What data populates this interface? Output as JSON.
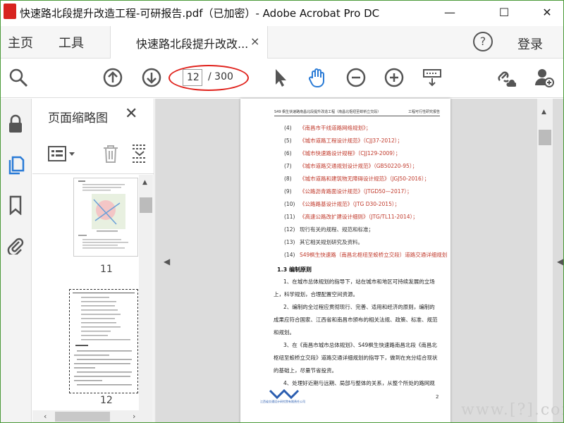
{
  "window": {
    "title": "快速路北段提升改造工程-可研报告.pdf（已加密）- Adobe Acrobat Pro DC",
    "minimize_glyph": "—",
    "maximize_glyph": "☐",
    "close_glyph": "✕"
  },
  "menu": {
    "home": "主页",
    "tools": "工具",
    "doc_tab": "快速路北段提升改改...",
    "doc_tab_close": "×",
    "help": "?",
    "login": "登录"
  },
  "toolbar": {
    "current_page": "12",
    "total_pages": "/ 300",
    "icons": [
      "zoom-search-icon",
      "prev-page-icon",
      "next-page-icon",
      "select-cursor-icon",
      "hand-tool-icon",
      "zoom-out-icon",
      "zoom-in-icon",
      "keyboard-icon",
      "share-link-icon",
      "add-user-icon"
    ]
  },
  "thumbnails": {
    "title": "页面缩略图",
    "close": "✕",
    "pages": [
      {
        "label": "11"
      },
      {
        "label": "12"
      }
    ]
  },
  "document": {
    "header_left": "S49 枫生快速路南昌北段提升改造工程（南昌北枢纽至蛟桥立交段）",
    "header_right": "工程可行性研究报告",
    "references": [
      {
        "num": "(4)",
        "text": "《南昌市干线道路网络规划》；"
      },
      {
        "num": "(5)",
        "text": "《城市道路工程设计规范》（CJJ37-2012）；"
      },
      {
        "num": "(6)",
        "text": "《城市快速路设计规程》（CJJ129-2009）；"
      },
      {
        "num": "(7)",
        "text": "《城市道路交通规划设计规范》（GB50220-95）；"
      },
      {
        "num": "(8)",
        "text": "《城市道路和建筑物无障碍设计规范》（JGJ50-2016）；"
      },
      {
        "num": "(9)",
        "text": "《公路沥青路面设计规范》（JTGD50—2017）；"
      },
      {
        "num": "(10)",
        "text": "《公路路基设计规范》（JTG D30-2015）；"
      },
      {
        "num": "(11)",
        "text": "《高速公路改扩建设计细则》（JTG/TL11-2014）；"
      },
      {
        "num": "(12)",
        "text": "现行有关的规程、规范和标准；"
      },
      {
        "num": "(13)",
        "text": "其它相关规划研究及资料。"
      },
      {
        "num": "(14)",
        "text": "S49枫生快速路（南昌北枢纽至蛟桥立交段）道路交通详细规划"
      }
    ],
    "section_title": "1.3 编制原则",
    "paragraphs": [
      "1、在城市总体规划的指导下，站在城市和地区可持续发展的立场上，科学规划，合理配置空间资源。",
      "2、编制的全过程应贯彻现行、完善、适用和经济的原则，编制的成果应符合国家、江西省和南昌市颁布的相关法规、政策、标准、规范和规划。",
      "3、在《南昌市城市总体规划》、S49枫生快速路南昌北段《南昌北枢纽至蛟桥立交段》道路交通详细规划的指导下，做到在充分结合现状的基础上，尽量节省投资。",
      "4、处理好近期与远期、局部与整体的关系，从整个所处的路网观"
    ],
    "page_number": "2",
    "footer_text": "江西省交通设计研究院有限责任公司"
  },
  "watermark": "www.[?].com"
}
